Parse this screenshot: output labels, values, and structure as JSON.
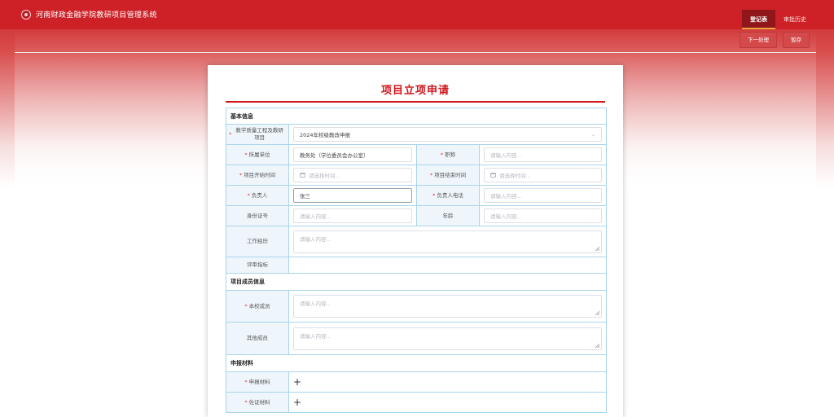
{
  "app": {
    "title": "河南财政金融学院教研项目管理系统"
  },
  "nav": {
    "items": [
      "登记表",
      "审批历史"
    ],
    "active": 0
  },
  "actions": {
    "next_label": "下一处理",
    "save_label": "暂存"
  },
  "form": {
    "title": "项目立项申请",
    "sections": {
      "basic": "基本信息",
      "members": "项目成员信息",
      "materials": "申报材料"
    },
    "fields": {
      "project_type": {
        "label": "教学质量工程及教研项目",
        "value": "2024年校级教改申报"
      },
      "department": {
        "label": "所属单位",
        "value": "教务处（学位委员会办公室）"
      },
      "title_rank": {
        "label": "职称",
        "placeholder": "请输入内容..."
      },
      "start_time": {
        "label": "项目开始时间",
        "placeholder": "请选择时间..."
      },
      "end_time": {
        "label": "项目结束时间",
        "placeholder": "请选择时间..."
      },
      "leader": {
        "label": "负责人",
        "value": "张三"
      },
      "leader_phone": {
        "label": "负责人电话",
        "placeholder": "请输入内容..."
      },
      "id_number": {
        "label": "身份证号",
        "placeholder": "请输入内容..."
      },
      "age": {
        "label": "年龄",
        "placeholder": "请输入内容..."
      },
      "work_history": {
        "label": "工作经历",
        "placeholder": "请输入内容..."
      },
      "review_index": {
        "label": "评审指标",
        "value": ""
      },
      "school_members": {
        "label": "本校成员",
        "placeholder": "请输入内容..."
      },
      "other_members": {
        "label": "其他成员",
        "placeholder": "请输入内容..."
      },
      "application_material": {
        "label": "申报材料",
        "action": "+"
      },
      "supporting_material": {
        "label": "佐证材料",
        "action": "+"
      }
    },
    "required_mark": "*"
  },
  "colors": {
    "brand_red": "#cd2127",
    "title_red": "#d0161b",
    "cell_border": "#a8d4ee",
    "label_bg": "#eef6fc"
  }
}
